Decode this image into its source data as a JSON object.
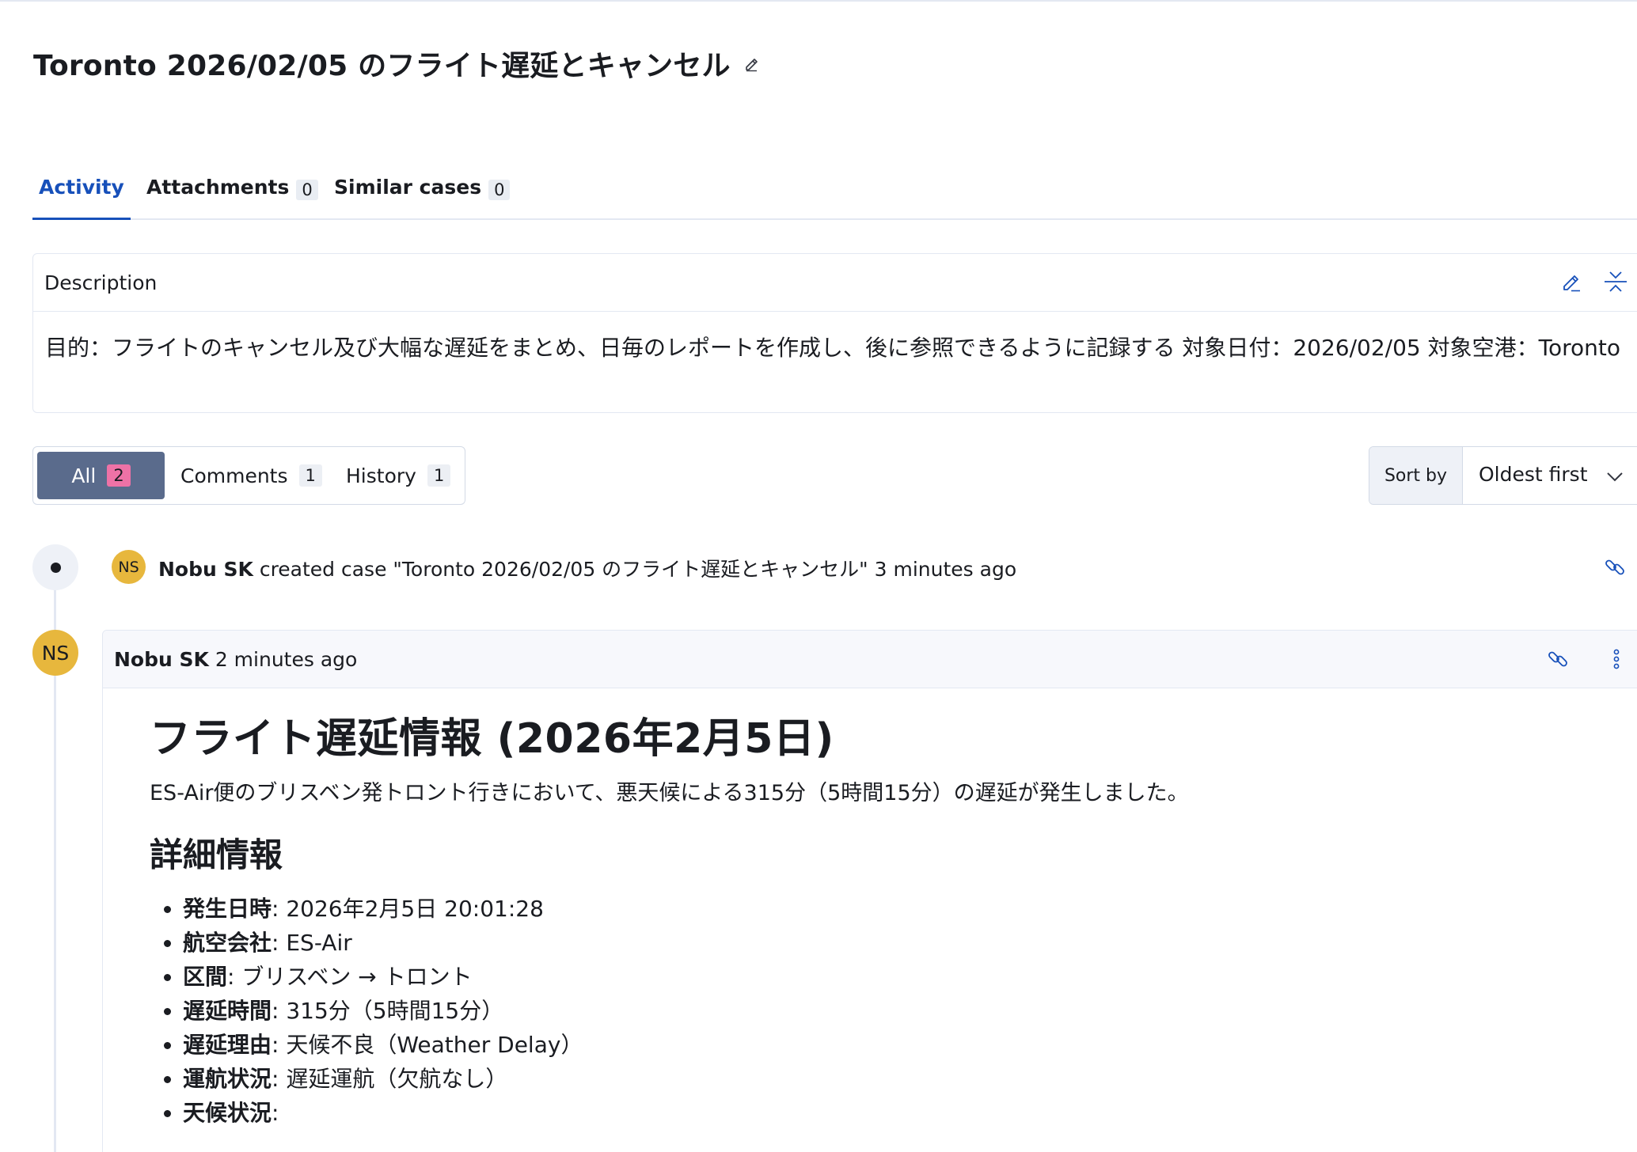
{
  "page": {
    "title": "Toronto 2026/02/05 のフライト遅延とキャンセル"
  },
  "tabs": [
    {
      "label": "Activity",
      "active": true
    },
    {
      "label": "Attachments",
      "count": "0"
    },
    {
      "label": "Similar cases",
      "count": "0"
    }
  ],
  "description": {
    "label": "Description",
    "text": "目的：フライトのキャンセル及び大幅な遅延をまとめ、日毎のレポートを作成し、後に参照できるように記録する 対象日付：2026/02/05 対象空港：Toronto"
  },
  "filters": [
    {
      "label": "All",
      "count": "2",
      "selected": true
    },
    {
      "label": "Comments",
      "count": "1"
    },
    {
      "label": "History",
      "count": "1"
    }
  ],
  "sort": {
    "label": "Sort by",
    "value": "Oldest first"
  },
  "events": [
    {
      "avatar": "NS",
      "user": "Nobu SK",
      "action": " created case \"Toronto 2026/02/05 のフライト遅延とキャンセル\" 3 minutes ago"
    }
  ],
  "comment": {
    "avatar": "NS",
    "user": "Nobu SK",
    "time": " 2 minutes ago",
    "heading": "フライト遅延情報 (2026年2月5日)",
    "summary": "ES-Air便のブリスベン発トロント行きにおいて、悪天候による315分（5時間15分）の遅延が発生しました。",
    "subheading": "詳細情報",
    "details": [
      {
        "key": "発生日時",
        "value": ": 2026年2月5日 20:01:28"
      },
      {
        "key": "航空会社",
        "value": ": ES-Air"
      },
      {
        "key": "区間",
        "value": ": ブリスベン → トロント"
      },
      {
        "key": "遅延時間",
        "value": ": 315分（5時間15分）"
      },
      {
        "key": "遅延理由",
        "value": ": 天候不良（Weather Delay）"
      },
      {
        "key": "運航状況",
        "value": ": 遅延運航（欠航なし）"
      },
      {
        "key": "天候状況",
        "value": ":"
      }
    ]
  },
  "colors": {
    "accent": "#1750ba",
    "avatar": "#e7b73d",
    "selected_filter": "#5a6b8c",
    "count_pink": "#ee72a6"
  },
  "icons": {
    "title_edit": "pencil-icon",
    "description_edit": "pencil-icon",
    "description_collapse": "collapse-icon",
    "sort_chevron": "chevron-down-icon",
    "event_link": "link-icon",
    "comment_link": "link-icon",
    "comment_more": "vertical-dots-icon"
  }
}
